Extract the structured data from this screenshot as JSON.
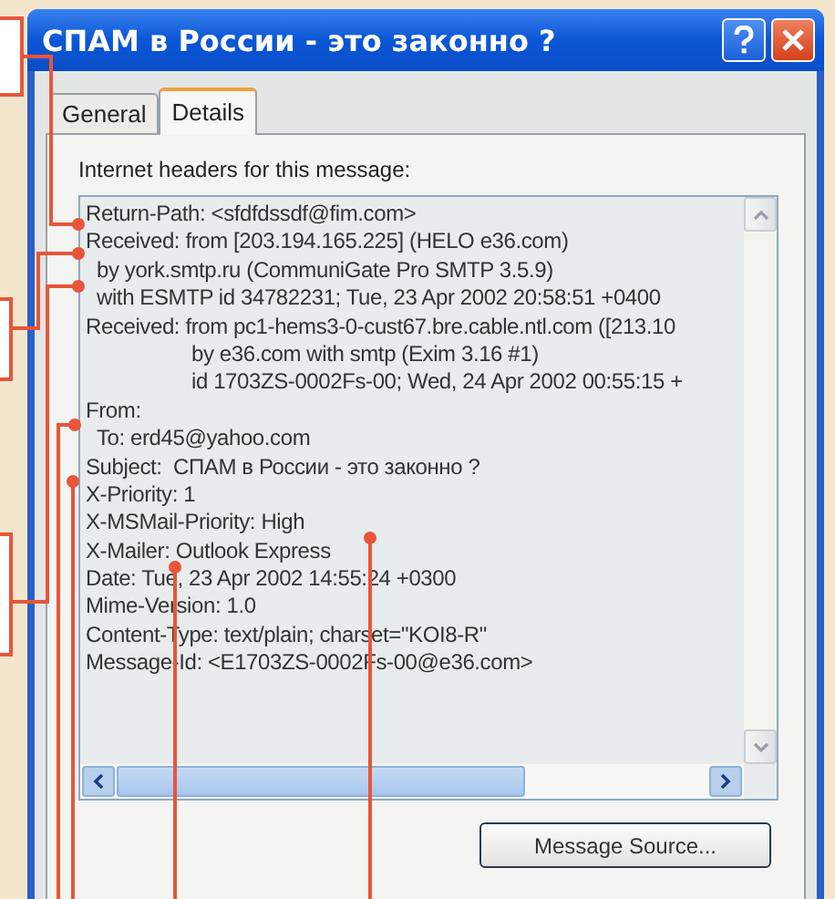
{
  "window": {
    "title": "СПАМ в России - это законно ?"
  },
  "tabs": [
    {
      "label": "General",
      "selected": false
    },
    {
      "label": "Details",
      "selected": true
    }
  ],
  "headers_label": "Internet headers for this message:",
  "header_lines": [
    {
      "kind": "header",
      "text": "Return-Path: <sfdfdssdf@fim.com>"
    },
    {
      "kind": "header",
      "text": "Received: from [203.194.165.225] (HELO e36.com)"
    },
    {
      "kind": "continuation",
      "text": "by york.smtp.ru (CommuniGate Pro SMTP 3.5.9)"
    },
    {
      "kind": "continuation",
      "text": "with ESMTP id 34782231; Tue, 23 Apr 2002 20:58:51 +0400"
    },
    {
      "kind": "header",
      "text": "Received: from pc1-hems3-0-cust67.bre.cable.ntl.com ([213.10"
    },
    {
      "kind": "deep",
      "text": "by e36.com with smtp (Exim 3.16 #1)"
    },
    {
      "kind": "deep",
      "text": "id 1703ZS-0002Fs-00; Wed, 24 Apr 2002 00:55:15 +"
    },
    {
      "kind": "header",
      "text": "From:"
    },
    {
      "kind": "continuation",
      "text": "To: erd45@yahoo.com"
    },
    {
      "kind": "header",
      "text": "Subject:  СПАМ в России - это законно ?"
    },
    {
      "kind": "header",
      "text": "X-Priority: 1"
    },
    {
      "kind": "header",
      "text": "X-MSMail-Priority: High"
    },
    {
      "kind": "header",
      "text": "X-Mailer: Outlook Express"
    },
    {
      "kind": "header",
      "text": "Date: Tue, 23 Apr 2002 14:55:24 +0300"
    },
    {
      "kind": "header",
      "text": "Mime-Version: 1.0"
    },
    {
      "kind": "header",
      "text": "Content-Type: text/plain; charset=\"KOI8-R\""
    },
    {
      "kind": "header",
      "text": "Message-Id: <E1703ZS-0002Fs-00@e36.com>"
    }
  ],
  "buttons": [
    "Message Source..."
  ]
}
